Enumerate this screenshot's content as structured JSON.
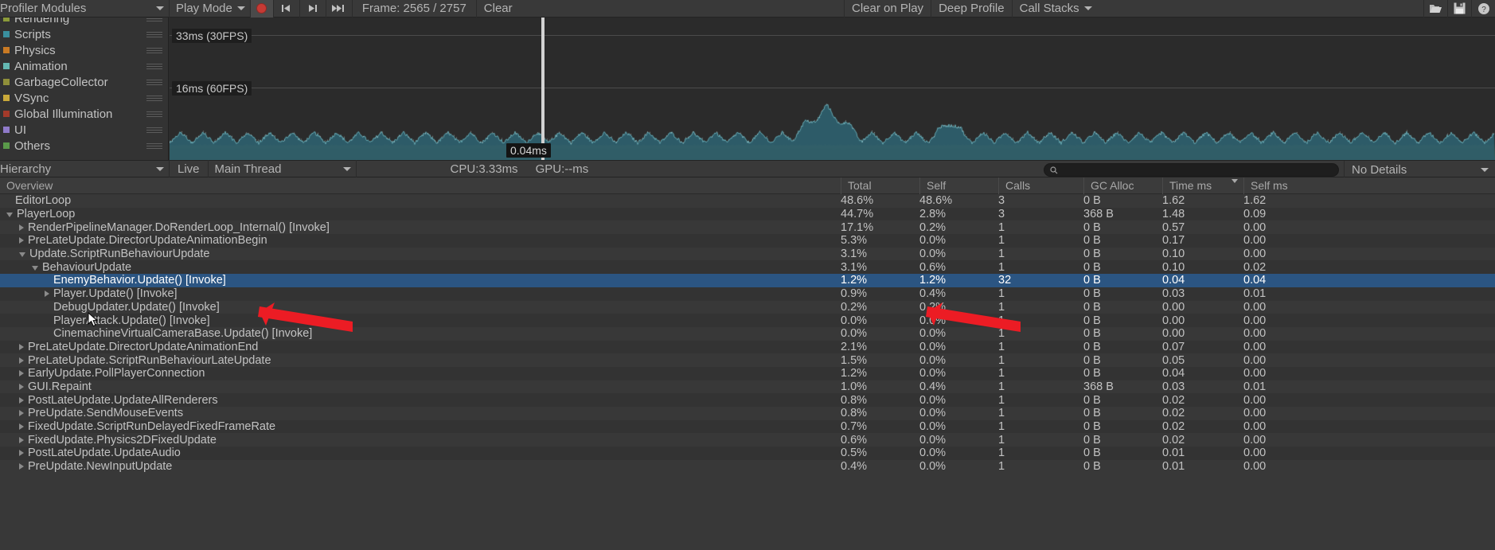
{
  "toolbar": {
    "modules_label": "Profiler Modules",
    "play_mode_label": "Play Mode",
    "record_icon": "record-icon",
    "prev_frame_icon": "previous-frame-icon",
    "next_frame_icon": "next-frame-icon",
    "last_frame_icon": "last-frame-icon",
    "frame_label": "Frame: 2565 / 2757",
    "clear_label": "Clear",
    "clear_on_play_label": "Clear on Play",
    "deep_profile_label": "Deep Profile",
    "call_stacks_label": "Call Stacks",
    "load_icon": "folder-open-icon",
    "save_icon": "save-icon",
    "help_icon": "help-icon"
  },
  "modules": [
    {
      "label": "Rendering",
      "color": "#8b9a3a"
    },
    {
      "label": "Scripts",
      "color": "#3a8f9e"
    },
    {
      "label": "Physics",
      "color": "#c97a24"
    },
    {
      "label": "Animation",
      "color": "#64b8b2"
    },
    {
      "label": "GarbageCollector",
      "color": "#8f8f3a"
    },
    {
      "label": "VSync",
      "color": "#c9a93a"
    },
    {
      "label": "Global Illumination",
      "color": "#a33a2a"
    },
    {
      "label": "UI",
      "color": "#8f7ac9"
    },
    {
      "label": "Others",
      "color": "#5a9a4a"
    }
  ],
  "graph": {
    "line_30fps": "33ms (30FPS)",
    "line_16fps": "16ms (60FPS)",
    "hover_value": "0.04ms"
  },
  "hierarchy_toolbar": {
    "view_label": "Hierarchy",
    "live_label": "Live",
    "thread_label": "Main Thread",
    "cpu_label": "CPU:3.33ms",
    "gpu_label": "GPU:--ms",
    "search_placeholder": "",
    "search_value": "",
    "search_icon": "search-icon",
    "details_label": "No Details"
  },
  "table": {
    "overview_label": "Overview",
    "columns": [
      {
        "key": "total",
        "label": "Total"
      },
      {
        "key": "self",
        "label": "Self"
      },
      {
        "key": "calls",
        "label": "Calls"
      },
      {
        "key": "gc",
        "label": "GC Alloc"
      },
      {
        "key": "timems",
        "label": "Time ms",
        "sorted": true
      },
      {
        "key": "selfms",
        "label": "Self ms"
      }
    ],
    "rows": [
      {
        "name": "EditorLoop",
        "depth": 0,
        "twisty": "none",
        "total": "48.6%",
        "self": "48.6%",
        "calls": "3",
        "gc": "0 B",
        "timems": "1.62",
        "selfms": "1.62",
        "selected": false
      },
      {
        "name": "PlayerLoop",
        "depth": 0,
        "twisty": "open",
        "total": "44.7%",
        "self": "2.8%",
        "calls": "3",
        "gc": "368 B",
        "timems": "1.48",
        "selfms": "0.09",
        "selected": false
      },
      {
        "name": "RenderPipelineManager.DoRenderLoop_Internal() [Invoke]",
        "depth": 1,
        "twisty": "closed",
        "total": "17.1%",
        "self": "0.2%",
        "calls": "1",
        "gc": "0 B",
        "timems": "0.57",
        "selfms": "0.00",
        "selected": false
      },
      {
        "name": "PreLateUpdate.DirectorUpdateAnimationBegin",
        "depth": 1,
        "twisty": "closed",
        "total": "5.3%",
        "self": "0.0%",
        "calls": "1",
        "gc": "0 B",
        "timems": "0.17",
        "selfms": "0.00",
        "selected": false
      },
      {
        "name": "Update.ScriptRunBehaviourUpdate",
        "depth": 1,
        "twisty": "open",
        "total": "3.1%",
        "self": "0.0%",
        "calls": "1",
        "gc": "0 B",
        "timems": "0.10",
        "selfms": "0.00",
        "selected": false
      },
      {
        "name": "BehaviourUpdate",
        "depth": 2,
        "twisty": "open",
        "total": "3.1%",
        "self": "0.6%",
        "calls": "1",
        "gc": "0 B",
        "timems": "0.10",
        "selfms": "0.02",
        "selected": false
      },
      {
        "name": "EnemyBehavior.Update() [Invoke]",
        "depth": 3,
        "twisty": "none",
        "total": "1.2%",
        "self": "1.2%",
        "calls": "32",
        "gc": "0 B",
        "timems": "0.04",
        "selfms": "0.04",
        "selected": true
      },
      {
        "name": "Player.Update() [Invoke]",
        "depth": 3,
        "twisty": "closed",
        "total": "0.9%",
        "self": "0.4%",
        "calls": "1",
        "gc": "0 B",
        "timems": "0.03",
        "selfms": "0.01",
        "selected": false
      },
      {
        "name": "DebugUpdater.Update() [Invoke]",
        "depth": 3,
        "twisty": "none",
        "total": "0.2%",
        "self": "0.2%",
        "calls": "1",
        "gc": "0 B",
        "timems": "0.00",
        "selfms": "0.00",
        "selected": false
      },
      {
        "name": "PlayerAttack.Update() [Invoke]",
        "depth": 3,
        "twisty": "none",
        "total": "0.0%",
        "self": "0.0%",
        "calls": "1",
        "gc": "0 B",
        "timems": "0.00",
        "selfms": "0.00",
        "selected": false
      },
      {
        "name": "CinemachineVirtualCameraBase.Update() [Invoke]",
        "depth": 3,
        "twisty": "none",
        "total": "0.0%",
        "self": "0.0%",
        "calls": "1",
        "gc": "0 B",
        "timems": "0.00",
        "selfms": "0.00",
        "selected": false
      },
      {
        "name": "PreLateUpdate.DirectorUpdateAnimationEnd",
        "depth": 1,
        "twisty": "closed",
        "total": "2.1%",
        "self": "0.0%",
        "calls": "1",
        "gc": "0 B",
        "timems": "0.07",
        "selfms": "0.00",
        "selected": false
      },
      {
        "name": "PreLateUpdate.ScriptRunBehaviourLateUpdate",
        "depth": 1,
        "twisty": "closed",
        "total": "1.5%",
        "self": "0.0%",
        "calls": "1",
        "gc": "0 B",
        "timems": "0.05",
        "selfms": "0.00",
        "selected": false
      },
      {
        "name": "EarlyUpdate.PollPlayerConnection",
        "depth": 1,
        "twisty": "closed",
        "total": "1.2%",
        "self": "0.0%",
        "calls": "1",
        "gc": "0 B",
        "timems": "0.04",
        "selfms": "0.00",
        "selected": false
      },
      {
        "name": "GUI.Repaint",
        "depth": 1,
        "twisty": "closed",
        "total": "1.0%",
        "self": "0.4%",
        "calls": "1",
        "gc": "368 B",
        "timems": "0.03",
        "selfms": "0.01",
        "selected": false
      },
      {
        "name": "PostLateUpdate.UpdateAllRenderers",
        "depth": 1,
        "twisty": "closed",
        "total": "0.8%",
        "self": "0.0%",
        "calls": "1",
        "gc": "0 B",
        "timems": "0.02",
        "selfms": "0.00",
        "selected": false
      },
      {
        "name": "PreUpdate.SendMouseEvents",
        "depth": 1,
        "twisty": "closed",
        "total": "0.8%",
        "self": "0.0%",
        "calls": "1",
        "gc": "0 B",
        "timems": "0.02",
        "selfms": "0.00",
        "selected": false
      },
      {
        "name": "FixedUpdate.ScriptRunDelayedFixedFrameRate",
        "depth": 1,
        "twisty": "closed",
        "total": "0.7%",
        "self": "0.0%",
        "calls": "1",
        "gc": "0 B",
        "timems": "0.02",
        "selfms": "0.00",
        "selected": false
      },
      {
        "name": "FixedUpdate.Physics2DFixedUpdate",
        "depth": 1,
        "twisty": "closed",
        "total": "0.6%",
        "self": "0.0%",
        "calls": "1",
        "gc": "0 B",
        "timems": "0.02",
        "selfms": "0.00",
        "selected": false
      },
      {
        "name": "PostLateUpdate.UpdateAudio",
        "depth": 1,
        "twisty": "closed",
        "total": "0.5%",
        "self": "0.0%",
        "calls": "1",
        "gc": "0 B",
        "timems": "0.01",
        "selfms": "0.00",
        "selected": false
      },
      {
        "name": "PreUpdate.NewInputUpdate",
        "depth": 1,
        "twisty": "closed",
        "total": "0.4%",
        "self": "0.0%",
        "calls": "1",
        "gc": "0 B",
        "timems": "0.01",
        "selfms": "0.00",
        "selected": false
      }
    ]
  },
  "annotation": {
    "arrow_color": "#ec1c24"
  },
  "colors": {
    "selection": "#2b5582",
    "toolbar_bg": "#393939",
    "panel_bg": "#383838",
    "graph_bg": "#2b2b2b"
  }
}
